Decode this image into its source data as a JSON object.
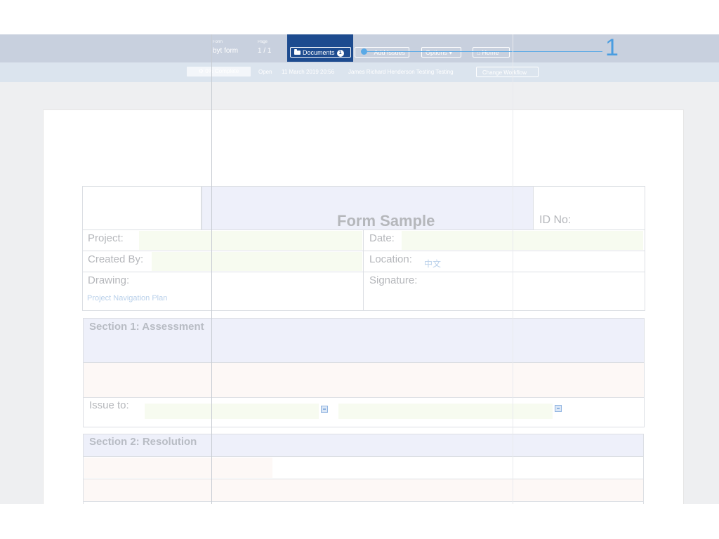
{
  "toolbar": {
    "form_label": "Form",
    "form_value": "byt form",
    "page_label": "Page",
    "page_current": "1",
    "page_separator": "/",
    "page_total": "1",
    "documents_label": "Documents",
    "documents_count": "1",
    "add_issues_label": "Add Issues",
    "options_label": "Options ▾",
    "home_label": "Home"
  },
  "workflow": {
    "complete_label": "0% Complete",
    "status": "Open",
    "datetime": "11 March 2019 20:56",
    "assignee": "James Richard Henderson Testing Testing",
    "change_label": "Change Workflow"
  },
  "callout": {
    "number": "1"
  },
  "form": {
    "title": "Form Sample",
    "id_label": "ID No:",
    "project_label": "Project:",
    "date_label": "Date:",
    "created_by_label": "Created By:",
    "location_label": "Location:",
    "location_value": "中文",
    "drawing_label": "Drawing:",
    "drawing_value": "Project Navigation Plan",
    "signature_label": "Signature:",
    "section1_title": "Section 1: Assessment",
    "issue_to_label": "Issue to:",
    "section2_title": "Section 2: Resolution"
  },
  "colors": {
    "toolbar_bg": "#c8d0de",
    "documents_active": "#1d4b8f",
    "callout": "#4a9de0"
  }
}
